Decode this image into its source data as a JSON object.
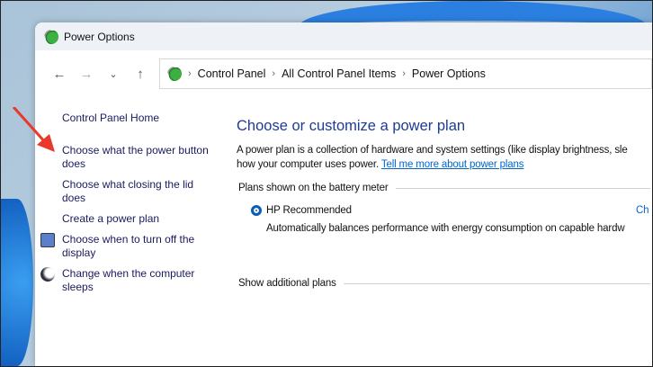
{
  "window": {
    "title": "Power Options"
  },
  "nav": {
    "back": "←",
    "forward": "→",
    "recent": "⌄",
    "up": "↑"
  },
  "breadcrumb": [
    "Control Panel",
    "All Control Panel Items",
    "Power Options"
  ],
  "sidebar": {
    "items": [
      {
        "label": "Control Panel Home"
      },
      {
        "label": "Choose what the power button does"
      },
      {
        "label": "Choose what closing the lid does"
      },
      {
        "label": "Create a power plan"
      },
      {
        "label": "Choose when to turn off the display",
        "icon": "display-clock-icon"
      },
      {
        "label": "Change when the computer sleeps",
        "icon": "moon-icon"
      }
    ]
  },
  "main": {
    "title": "Choose or customize a power plan",
    "desc_line1": "A power plan is a collection of hardware and system settings (like display brightness, sle",
    "desc_line2": "how your computer uses power.",
    "link": "Tell me more about power plans",
    "group_label": "Plans shown on the battery meter",
    "plan_name": "HP Recommended",
    "plan_change": "Ch",
    "plan_desc": "Automatically balances performance with energy consumption on capable hardw",
    "additional": "Show additional plans"
  },
  "colors": {
    "heading": "#1e3c96",
    "link": "#0066cc",
    "annotation_arrow": "#e8392b"
  }
}
